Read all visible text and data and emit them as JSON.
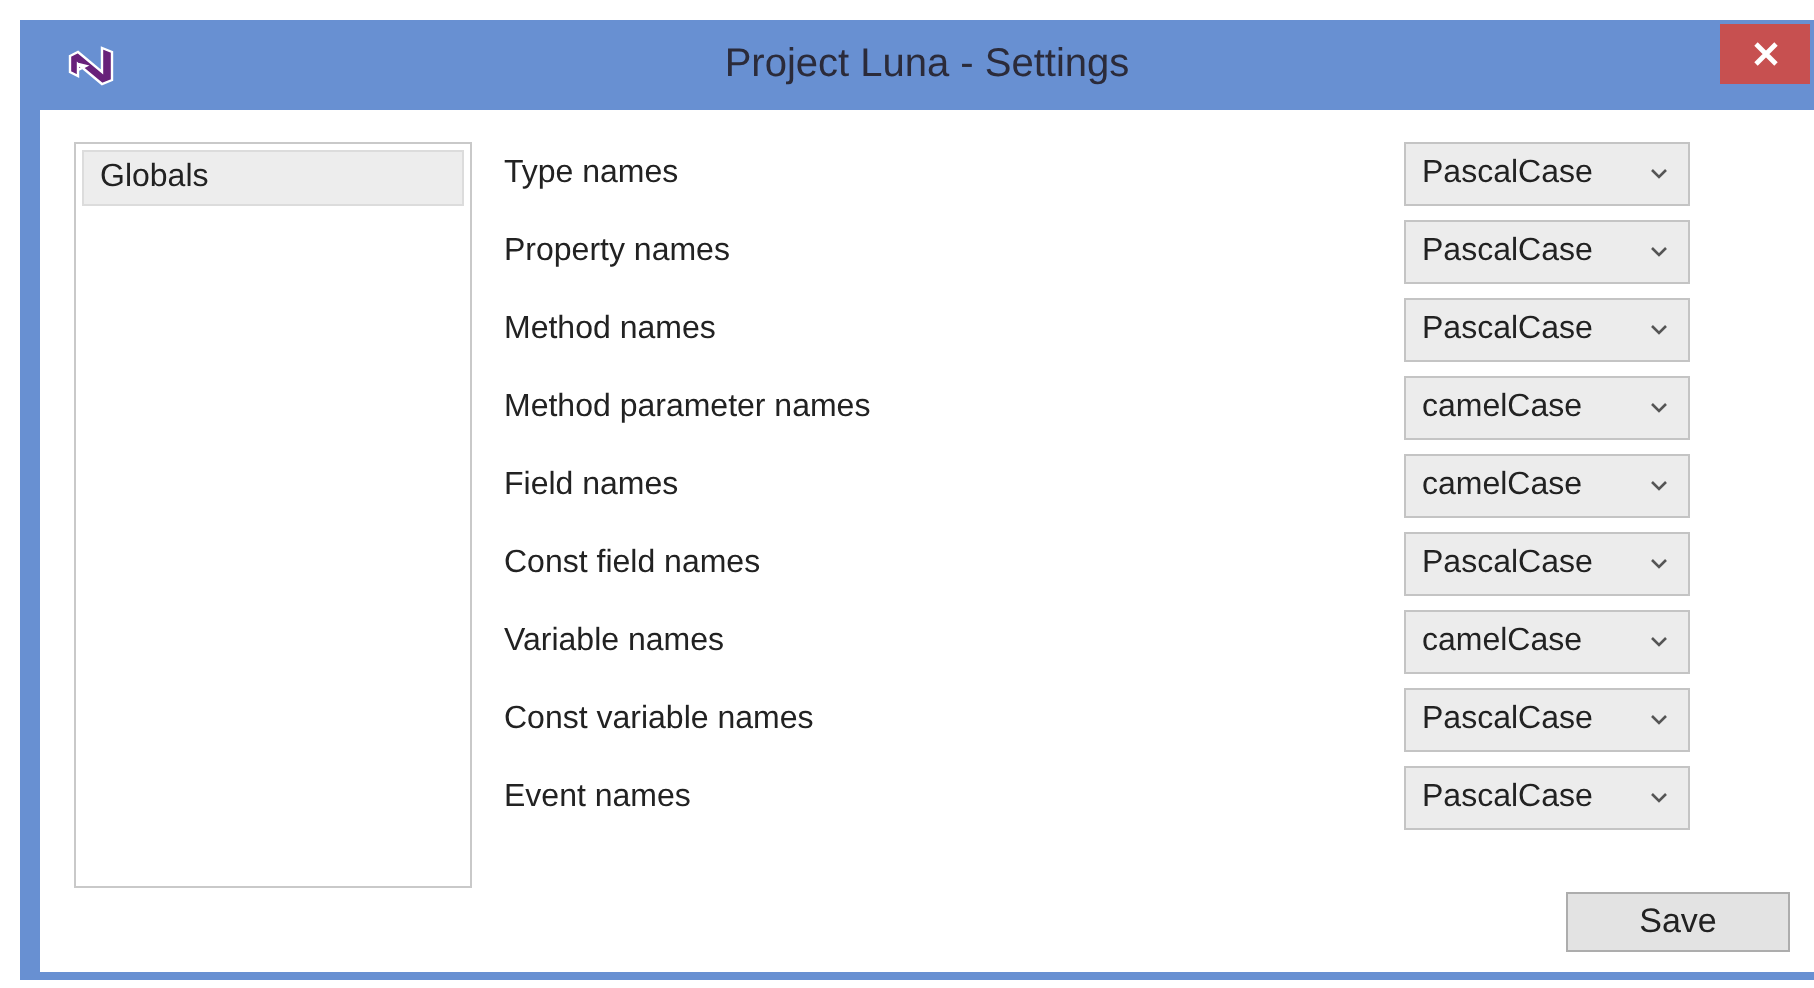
{
  "window": {
    "title": "Project Luna - Settings"
  },
  "sidebar": {
    "items": [
      {
        "label": "Globals",
        "selected": true
      }
    ]
  },
  "settings": [
    {
      "label": "Type names",
      "value": "PascalCase"
    },
    {
      "label": "Property names",
      "value": "PascalCase"
    },
    {
      "label": "Method names",
      "value": "PascalCase"
    },
    {
      "label": "Method parameter names",
      "value": "camelCase"
    },
    {
      "label": "Field names",
      "value": "camelCase"
    },
    {
      "label": "Const field names",
      "value": "PascalCase"
    },
    {
      "label": "Variable names",
      "value": "camelCase"
    },
    {
      "label": "Const variable names",
      "value": "PascalCase"
    },
    {
      "label": "Event names",
      "value": "PascalCase"
    }
  ],
  "buttons": [
    "Save"
  ]
}
